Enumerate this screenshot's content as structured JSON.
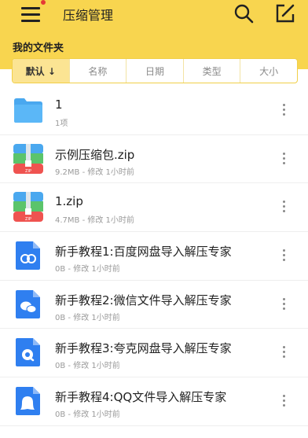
{
  "app": {
    "title": "压缩管理",
    "folder_title": "我的文件夹"
  },
  "sort": {
    "tabs": [
      "默认 ↓",
      "名称",
      "日期",
      "类型",
      "大小"
    ],
    "active_index": 0
  },
  "files": [
    {
      "name": "1",
      "meta": "1项",
      "type": "folder",
      "icon": "folder-icon"
    },
    {
      "name": "示例压缩包.zip",
      "meta": "9.2MB - 修改 1小时前",
      "type": "zip",
      "icon": "zip-icon"
    },
    {
      "name": "1.zip",
      "meta": "4.7MB - 修改 1小时前",
      "type": "zip",
      "icon": "zip-icon"
    },
    {
      "name": "新手教程1:百度网盘导入解压专家",
      "meta": "0B - 修改 1小时前",
      "type": "doc",
      "icon": "baidu-cloud-icon"
    },
    {
      "name": "新手教程2:微信文件导入解压专家",
      "meta": "0B - 修改 1小时前",
      "type": "doc",
      "icon": "wechat-icon"
    },
    {
      "name": "新手教程3:夸克网盘导入解压专家",
      "meta": "0B - 修改 1小时前",
      "type": "doc",
      "icon": "quark-icon"
    },
    {
      "name": "新手教程4:QQ文件导入解压专家",
      "meta": "0B - 修改 1小时前",
      "type": "doc",
      "icon": "qq-icon"
    }
  ],
  "colors": {
    "header": "#f8d54f",
    "folder": "#4aa8ef",
    "doc": "#2f7ff0"
  }
}
